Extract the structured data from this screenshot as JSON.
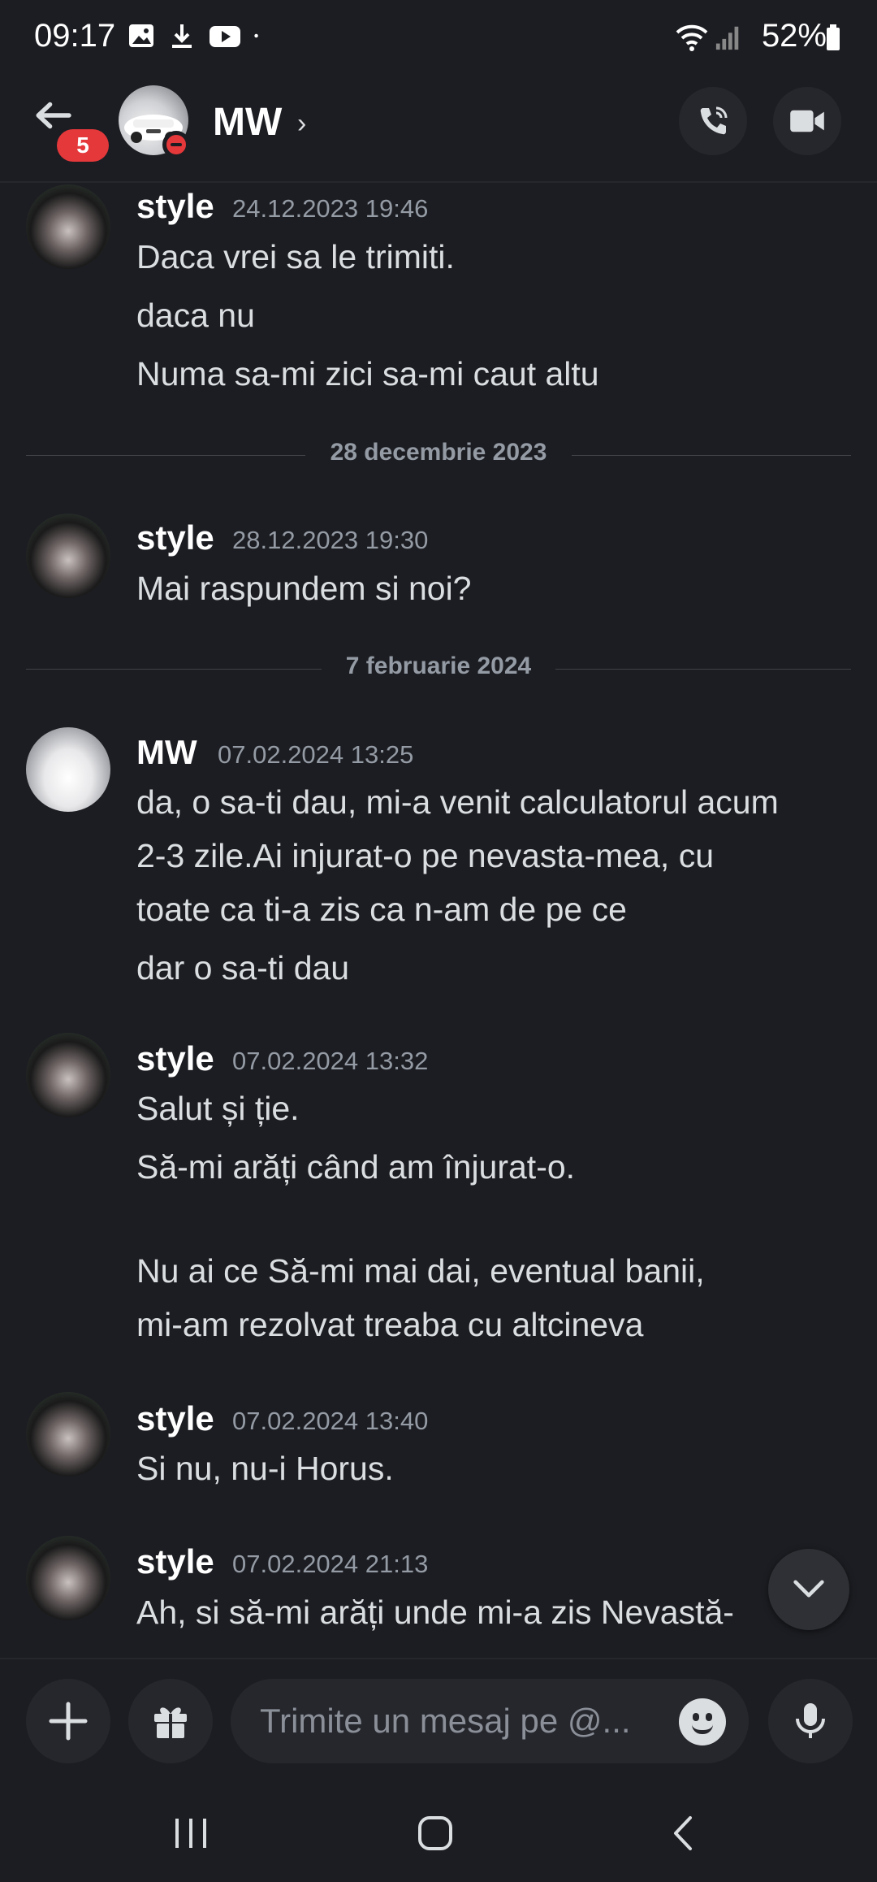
{
  "status_bar": {
    "time": "09:17",
    "battery": "52%"
  },
  "header": {
    "name": "MW",
    "chevron": "›",
    "unread_badge": "5"
  },
  "dividers": [
    "28 decembrie 2023",
    "7 februarie 2024"
  ],
  "messages": [
    {
      "author": "style",
      "timestamp": "24.12.2023 19:46",
      "lines": [
        "Daca vrei sa le trimiti.",
        "daca nu",
        "Numa sa-mi zici sa-mi caut altu"
      ]
    },
    {
      "author": "style",
      "timestamp": "28.12.2023 19:30",
      "lines": [
        "Mai raspundem si noi?"
      ]
    },
    {
      "author": "MW",
      "timestamp": "07.02.2024 13:25",
      "lines": [
        "da, o sa-ti dau, mi-a venit calculatorul acum",
        "2-3 zile.Ai injurat-o pe nevasta-mea, cu",
        "toate ca ti-a zis ca n-am de pe ce",
        "dar o sa-ti dau"
      ]
    },
    {
      "author": "style",
      "timestamp": "07.02.2024 13:32",
      "lines": [
        "Salut și ție.",
        "Să-mi arăți când am înjurat-o.",
        "Nu ai ce Să-mi mai dai, eventual banii,",
        "mi-am rezolvat treaba cu altcineva"
      ]
    },
    {
      "author": "style",
      "timestamp": "07.02.2024 13:40",
      "lines": [
        "Si nu, nu-i Horus."
      ]
    },
    {
      "author": "style",
      "timestamp": "07.02.2024 21:13",
      "lines": [
        "Ah, si să-mi arăți unde mi-a zis Nevastă-"
      ]
    }
  ],
  "composer": {
    "placeholder": "Trimite un mesaj pe @..."
  },
  "icons": {
    "back": "arrow-left-icon",
    "call": "phone-icon",
    "video": "video-camera-icon",
    "add": "plus-icon",
    "gift": "gift-icon",
    "emoji": "emoji-icon",
    "mic": "microphone-icon",
    "scroll": "chevron-down-icon"
  },
  "colors": {
    "background": "#1c1d22",
    "surface": "#26272d",
    "badge": "#e5383b",
    "muted": "#949ba4"
  }
}
